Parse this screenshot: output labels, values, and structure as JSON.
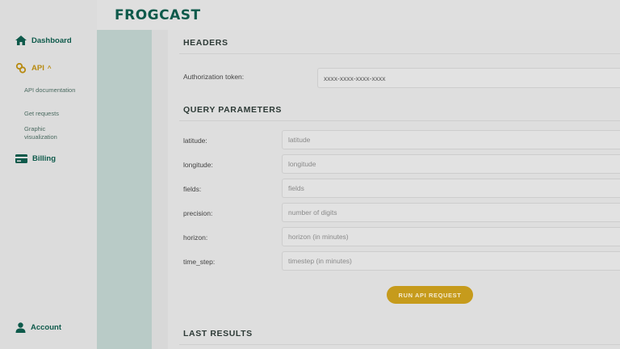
{
  "logo": {
    "text": "FROGCAST"
  },
  "sidebar": {
    "dashboard": {
      "label": "Dashboard",
      "icon": "home-icon"
    },
    "api": {
      "label": "API",
      "icon": "api-icon",
      "chevron": "^"
    },
    "sub_items": [
      {
        "label": "API documentation"
      },
      {
        "label": "Get requests"
      },
      {
        "label": "Graphic visualization"
      }
    ],
    "billing": {
      "label": "Billing",
      "icon": "billing-icon"
    },
    "account": {
      "label": "Account",
      "icon": "user-icon"
    }
  },
  "headers": {
    "title": "HEADERS",
    "auth_label": "Authorization token:",
    "auth_value": "xxxx-xxxx-xxxx-xxxx"
  },
  "query": {
    "title": "QUERY PARAMETERS",
    "fields": [
      {
        "label": "latitude:",
        "placeholder": "latitude"
      },
      {
        "label": "longitude:",
        "placeholder": "longitude"
      },
      {
        "label": "fields:",
        "placeholder": "fields"
      },
      {
        "label": "precision:",
        "placeholder": "number of digits"
      },
      {
        "label": "horizon:",
        "placeholder": "horizon (in minutes)"
      },
      {
        "label": "time_step:",
        "placeholder": "timestep (in minutes)"
      }
    ]
  },
  "run_button": {
    "label": "RUN API REQUEST"
  },
  "last_results": {
    "title": "LAST RESULTS"
  },
  "colors": {
    "brand_green": "#0e5a4b",
    "accent_gold": "#c69b1c",
    "teal_panel": "#b9cbc7"
  }
}
